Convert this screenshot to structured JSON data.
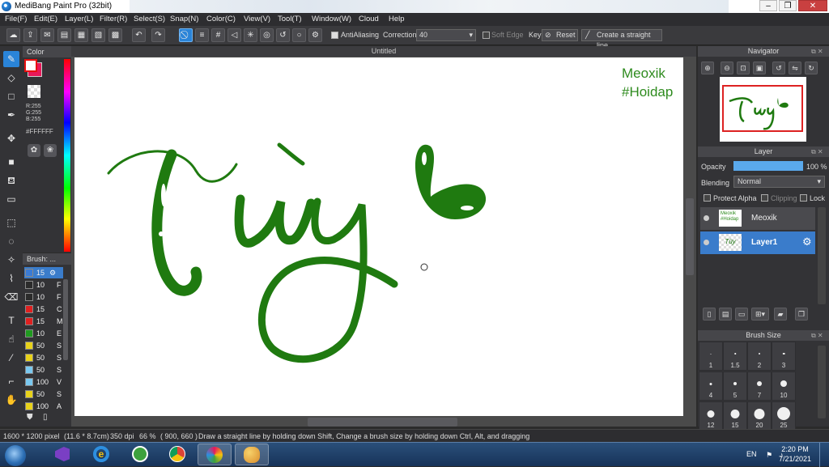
{
  "window": {
    "title": "MediBang Paint Pro (32bit)"
  },
  "menu": [
    "File(F)",
    "Edit(E)",
    "Layer(L)",
    "Filter(R)",
    "Select(S)",
    "Snap(N)",
    "Color(C)",
    "View(V)",
    "Tool(T)",
    "Window(W)",
    "Cloud",
    "Help"
  ],
  "toolbar": {
    "antialiasing_label": "AntiAliasing",
    "correction_label": "Correction",
    "correction_value": "40",
    "soft_edge_label": "Soft Edge",
    "key_label": "Key",
    "reset_label": "Reset",
    "straight_line_label": "Create a straight line"
  },
  "color_panel": {
    "title": "Color",
    "r": "R:255",
    "g": "G:255",
    "b": "B:255",
    "hex": "#FFFFFF"
  },
  "brush_panel": {
    "title": "Brush: ...",
    "items": [
      {
        "size": "15",
        "color": "#3a7bd5",
        "name": ""
      },
      {
        "size": "10",
        "color": "#2b2b2b",
        "name": "F"
      },
      {
        "size": "10",
        "color": "#2b2b2b",
        "name": "F"
      },
      {
        "size": "15",
        "color": "#e02020",
        "name": "C"
      },
      {
        "size": "15",
        "color": "#e02020",
        "name": "M"
      },
      {
        "size": "10",
        "color": "#1f9a1f",
        "name": "E"
      },
      {
        "size": "50",
        "color": "#e8d21a",
        "name": "S"
      },
      {
        "size": "50",
        "color": "#e8d21a",
        "name": "S"
      },
      {
        "size": "50",
        "color": "#7ac8f0",
        "name": "S"
      },
      {
        "size": "100",
        "color": "#7ac8f0",
        "name": "V"
      },
      {
        "size": "50",
        "color": "#e8d21a",
        "name": "S"
      },
      {
        "size": "100",
        "color": "#e8d21a",
        "name": "A"
      }
    ]
  },
  "canvas": {
    "tab_title": "Untitled",
    "watermark_line1": "Meoxik",
    "watermark_line2": "#Hoidap",
    "drawing_text": "Tùy"
  },
  "navigator": {
    "title": "Navigator"
  },
  "layer_panel": {
    "title": "Layer",
    "opacity_label": "Opacity",
    "opacity_value": "100 %",
    "opacity_fraction": 1.0,
    "blending_label": "Blending",
    "blending_value": "Normal",
    "protect_alpha_label": "Protect Alpha",
    "clipping_label": "Clipping",
    "lock_label": "Lock",
    "layers": [
      {
        "name": "Meoxik",
        "thumb_text_1": "Meoxik",
        "thumb_text_2": "#Hoidap"
      },
      {
        "name": "Layer1",
        "thumb_text_1": "Tùy"
      }
    ]
  },
  "brush_size_panel": {
    "title": "Brush Size",
    "sizes": [
      "1",
      "1.5",
      "2",
      "3",
      "4",
      "5",
      "7",
      "10",
      "12",
      "15",
      "20",
      "25"
    ]
  },
  "status": {
    "size": "1600 * 1200 pixel",
    "physical": "(11.6 * 8.7cm)",
    "dpi": "350 dpi",
    "zoom": "66 %",
    "coords": "( 900, 660 )",
    "hint": "Draw a straight line by holding down Shift, Change a brush size by holding down Ctrl, Alt, and dragging"
  },
  "taskbar": {
    "lang": "EN",
    "time": "2:20 PM",
    "date": "7/21/2021"
  },
  "colors": {
    "accent": "#2a84d8",
    "ink": "#1f7a10",
    "watermark": "#2e8b1e"
  }
}
